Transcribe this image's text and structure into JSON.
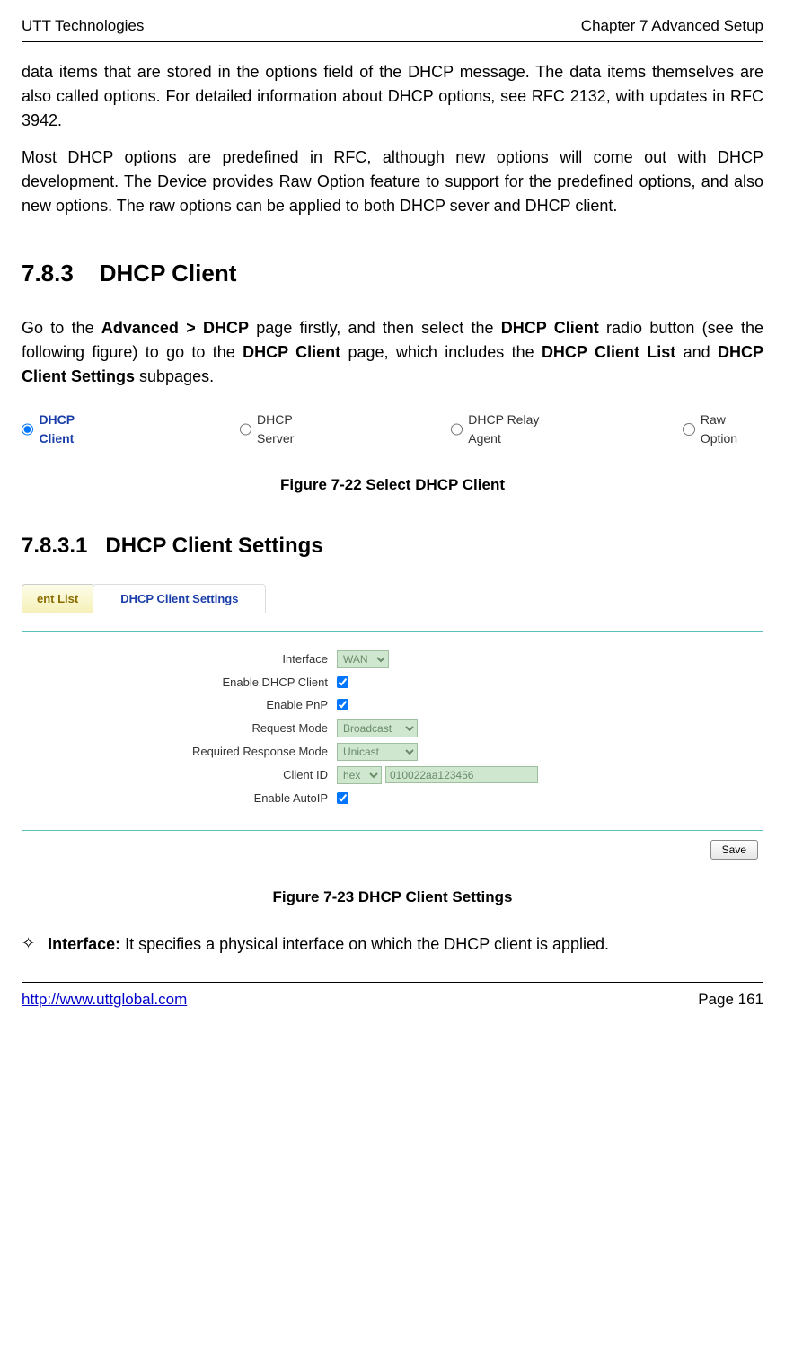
{
  "header": {
    "left": "UTT Technologies",
    "right": "Chapter 7 Advanced Setup"
  },
  "para1": "data items that are stored in the options field of the DHCP message. The data items themselves are also called options. For detailed information about DHCP options, see RFC 2132, with updates in RFC 3942.",
  "para2": "Most DHCP options are predefined in RFC, although new options will come out with DHCP development. The Device provides Raw Option feature to support for the predefined options, and also new options. The raw options can be applied to both DHCP sever and DHCP client.",
  "section_num": "7.8.3",
  "section_title": "DHCP Client",
  "intro_pre": "Go to the ",
  "intro_b1": "Advanced > DHCP",
  "intro_mid1": " page firstly, and then select the ",
  "intro_b2": "DHCP Client",
  "intro_mid2": " radio button (see the following figure) to go to the ",
  "intro_b3": "DHCP Client",
  "intro_mid3": " page, which includes the ",
  "intro_b4": "DHCP Client List",
  "intro_mid4": " and ",
  "intro_b5": "DHCP Client Settings",
  "intro_end": " subpages.",
  "radios": {
    "r1": "DHCP Client",
    "r2": "DHCP Server",
    "r3": "DHCP Relay Agent",
    "r4": "Raw Option"
  },
  "fig22": "Figure 7-22 Select DHCP Client",
  "sub_num": "7.8.3.1",
  "sub_title": "DHCP Client Settings",
  "tabs": {
    "left": "ent List",
    "right": "DHCP Client Settings"
  },
  "form": {
    "interface_label": "Interface",
    "interface_value": "WAN",
    "enable_client_label": "Enable DHCP Client",
    "enable_pnp_label": "Enable PnP",
    "request_mode_label": "Request Mode",
    "request_mode_value": "Broadcast",
    "response_mode_label": "Required Response Mode",
    "response_mode_value": "Unicast",
    "clientid_label": "Client ID",
    "clientid_type": "hex",
    "clientid_value": "010022aa123456",
    "enable_autoip_label": "Enable AutoIP",
    "save": "Save"
  },
  "fig23": "Figure 7-23 DHCP Client Settings",
  "bullet_label": "Interface:",
  "bullet_text": " It specifies a physical interface on which the DHCP client is applied.",
  "footer": {
    "link": "http://www.uttglobal.com",
    "page": "Page 161"
  }
}
